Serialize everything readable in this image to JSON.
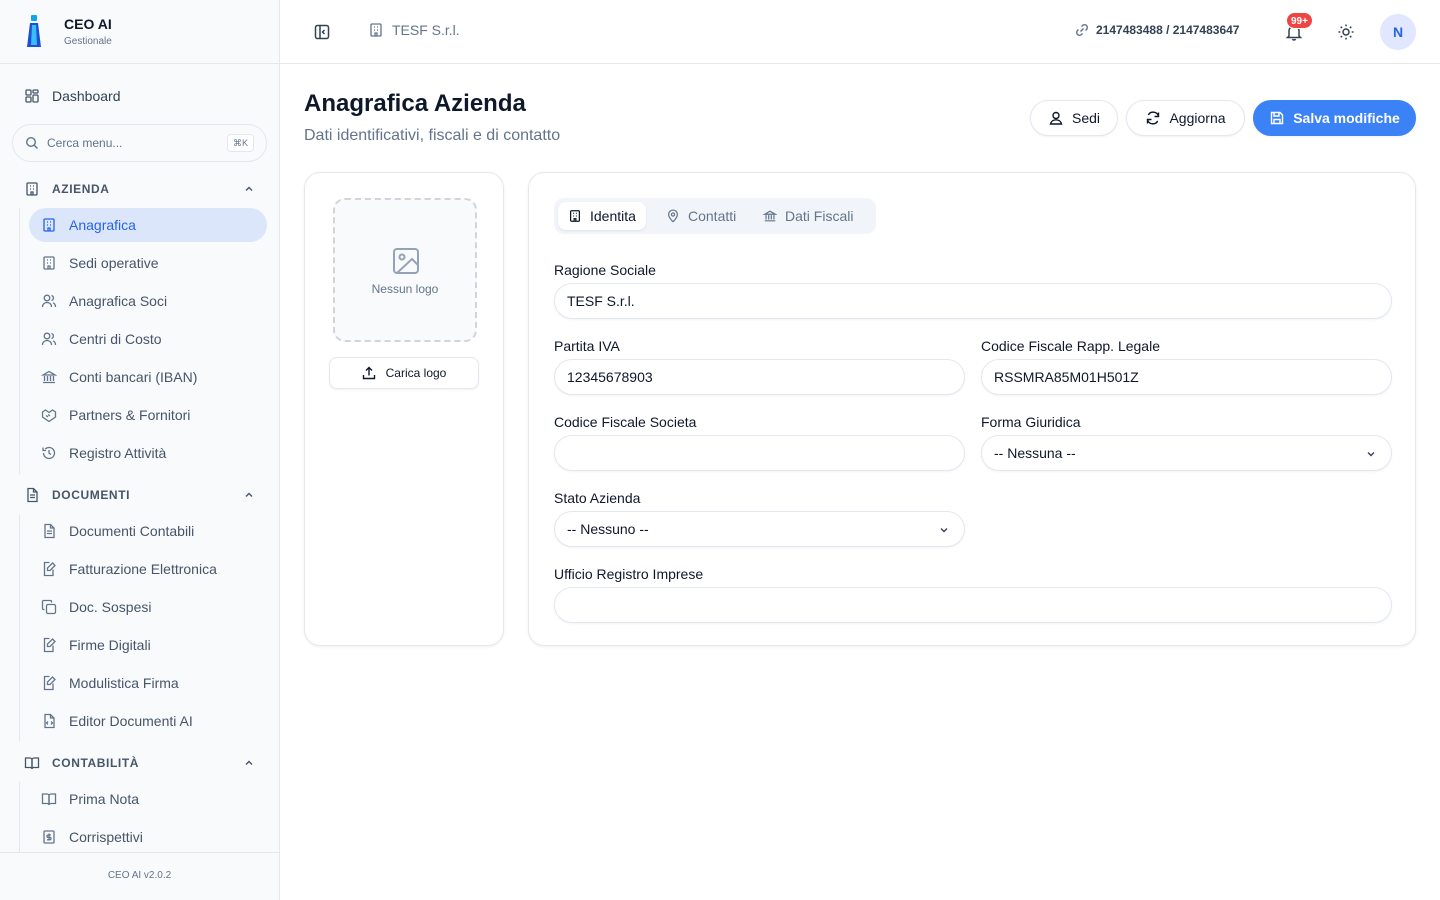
{
  "brand": {
    "title": "CEO AI",
    "subtitle": "Gestionale"
  },
  "sidebar": {
    "dashboard": "Dashboard",
    "search": {
      "placeholder": "Cerca menu...",
      "shortcut": "⌘K"
    },
    "sections": [
      {
        "label": "AZIENDA",
        "items": [
          {
            "label": "Anagrafica",
            "icon": "building-icon",
            "active": true
          },
          {
            "label": "Sedi operative",
            "icon": "building-icon"
          },
          {
            "label": "Anagrafica Soci",
            "icon": "users-icon"
          },
          {
            "label": "Centri di Costo",
            "icon": "users-icon"
          },
          {
            "label": "Conti bancari (IBAN)",
            "icon": "bank-icon"
          },
          {
            "label": "Partners & Fornitori",
            "icon": "handshake-icon"
          },
          {
            "label": "Registro Attività",
            "icon": "history-icon"
          }
        ]
      },
      {
        "label": "DOCUMENTI",
        "items": [
          {
            "label": "Documenti Contabili",
            "icon": "file-text-icon"
          },
          {
            "label": "Fatturazione Elettronica",
            "icon": "file-edit-icon"
          },
          {
            "label": "Doc. Sospesi",
            "icon": "copy-icon"
          },
          {
            "label": "Firme Digitali",
            "icon": "file-signature-icon"
          },
          {
            "label": "Modulistica Firma",
            "icon": "file-signature-icon"
          },
          {
            "label": "Editor Documenti AI",
            "icon": "file-code-icon"
          }
        ]
      },
      {
        "label": "CONTABILITÀ",
        "items": [
          {
            "label": "Prima Nota",
            "icon": "book-icon"
          },
          {
            "label": "Corrispettivi",
            "icon": "receipt-icon"
          }
        ]
      }
    ],
    "footer": "CEO AI v2.0.2"
  },
  "header": {
    "company": "TESF S.r.l.",
    "ids": "2147483488 / 2147483647",
    "notifications": "99+",
    "avatar": "N"
  },
  "page": {
    "title": "Anagrafica Azienda",
    "subtitle": "Dati identificativi, fiscali e di contatto",
    "buttons": {
      "sedi": "Sedi",
      "refresh": "Aggiorna",
      "save": "Salva modifiche"
    }
  },
  "logo": {
    "empty_label": "Nessun logo",
    "upload_label": "Carica logo"
  },
  "tabs": [
    "Identita",
    "Contatti",
    "Dati Fiscali"
  ],
  "form": {
    "ragione_sociale": {
      "label": "Ragione Sociale",
      "value": "TESF S.r.l."
    },
    "partita_iva": {
      "label": "Partita IVA",
      "value": "12345678903"
    },
    "cf_rapp_legale": {
      "label": "Codice Fiscale Rapp. Legale",
      "value": "RSSMRA85M01H501Z"
    },
    "cf_societa": {
      "label": "Codice Fiscale Societa",
      "value": ""
    },
    "forma_giuridica": {
      "label": "Forma Giuridica",
      "value": "-- Nessuna --"
    },
    "stato_azienda": {
      "label": "Stato Azienda",
      "value": "-- Nessuno --"
    },
    "ufficio_registro": {
      "label": "Ufficio Registro Imprese",
      "value": ""
    }
  },
  "colors": {
    "accent": "#3b82f6",
    "active_bg": "#dbe6fb",
    "badge": "#ef4444"
  }
}
